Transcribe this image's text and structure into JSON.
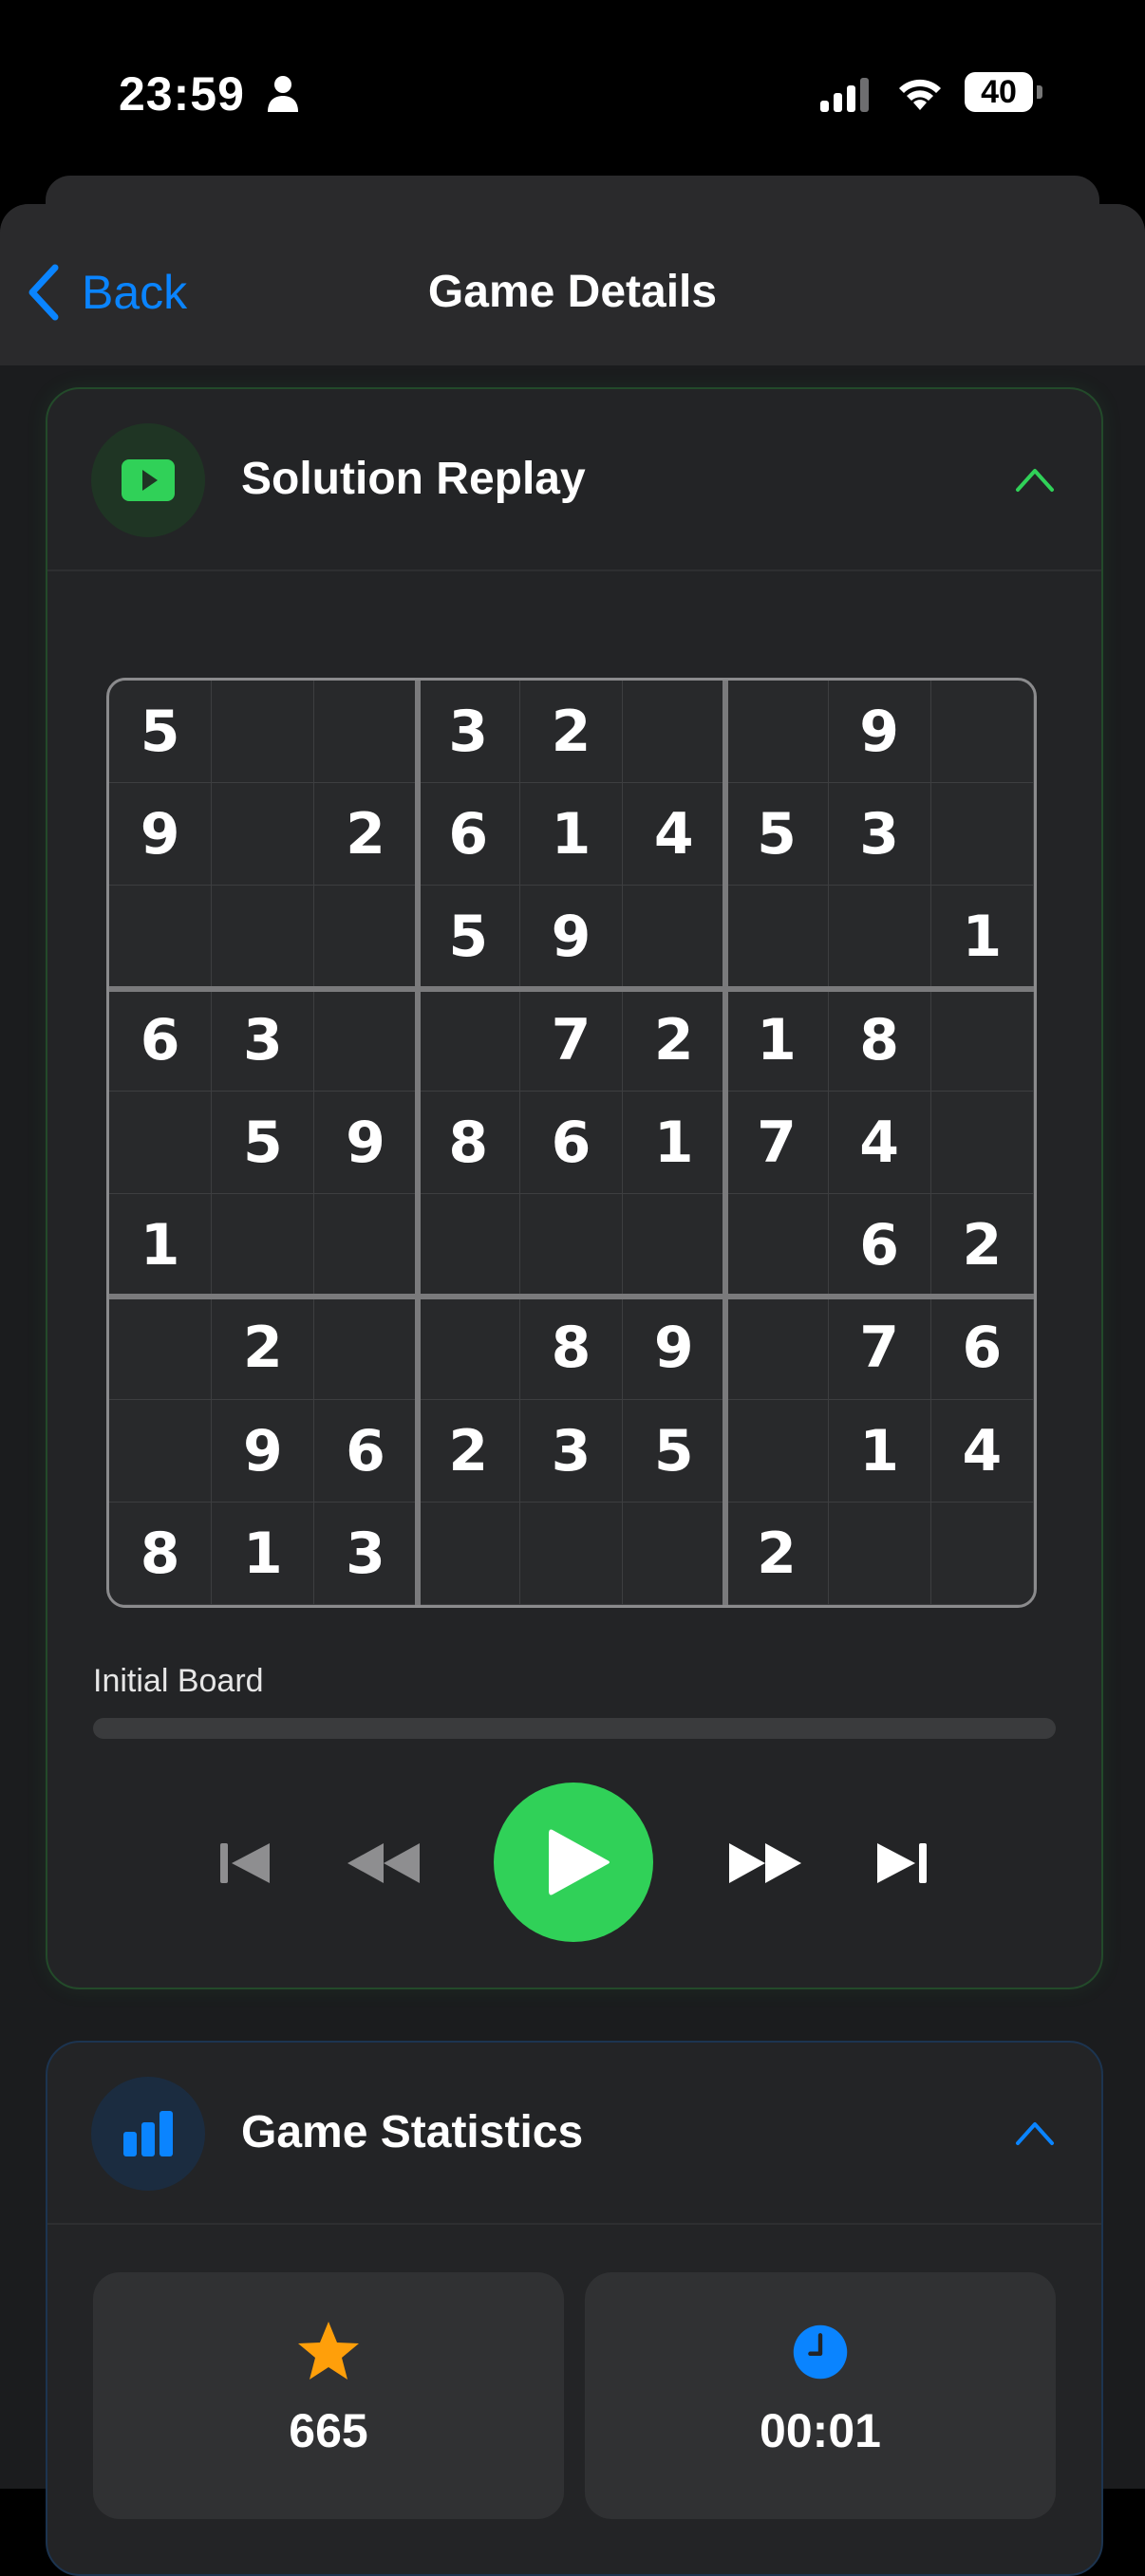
{
  "status_bar": {
    "time": "23:59",
    "battery": "40"
  },
  "nav": {
    "back_label": "Back",
    "title": "Game Details"
  },
  "replay": {
    "title": "Solution Replay",
    "grid": [
      [
        "5",
        "",
        "",
        "3",
        "2",
        "",
        "",
        "9",
        ""
      ],
      [
        "9",
        "",
        "2",
        "6",
        "1",
        "4",
        "5",
        "3",
        ""
      ],
      [
        "",
        "",
        "",
        "5",
        "9",
        "",
        "",
        "",
        "1"
      ],
      [
        "6",
        "3",
        "",
        "",
        "7",
        "2",
        "1",
        "8",
        ""
      ],
      [
        "",
        "5",
        "9",
        "8",
        "6",
        "1",
        "7",
        "4",
        ""
      ],
      [
        "1",
        "",
        "",
        "",
        "",
        "",
        "",
        "6",
        "2"
      ],
      [
        "",
        "2",
        "",
        "",
        "8",
        "9",
        "",
        "7",
        "6"
      ],
      [
        "",
        "9",
        "6",
        "2",
        "3",
        "5",
        "",
        "1",
        "4"
      ],
      [
        "8",
        "1",
        "3",
        "",
        "",
        "",
        "2",
        "",
        ""
      ]
    ],
    "step_label": "Initial Board",
    "progress": 0
  },
  "stats": {
    "title": "Game Statistics",
    "tiles": [
      {
        "icon": "star-icon",
        "value": "665",
        "color": "#ff9f0a"
      },
      {
        "icon": "clock-icon",
        "value": "00:01",
        "color": "#0a84ff"
      }
    ]
  },
  "colors": {
    "accent_green": "#30d158",
    "accent_blue": "#0a84ff",
    "back_blue": "#0a84ff"
  }
}
